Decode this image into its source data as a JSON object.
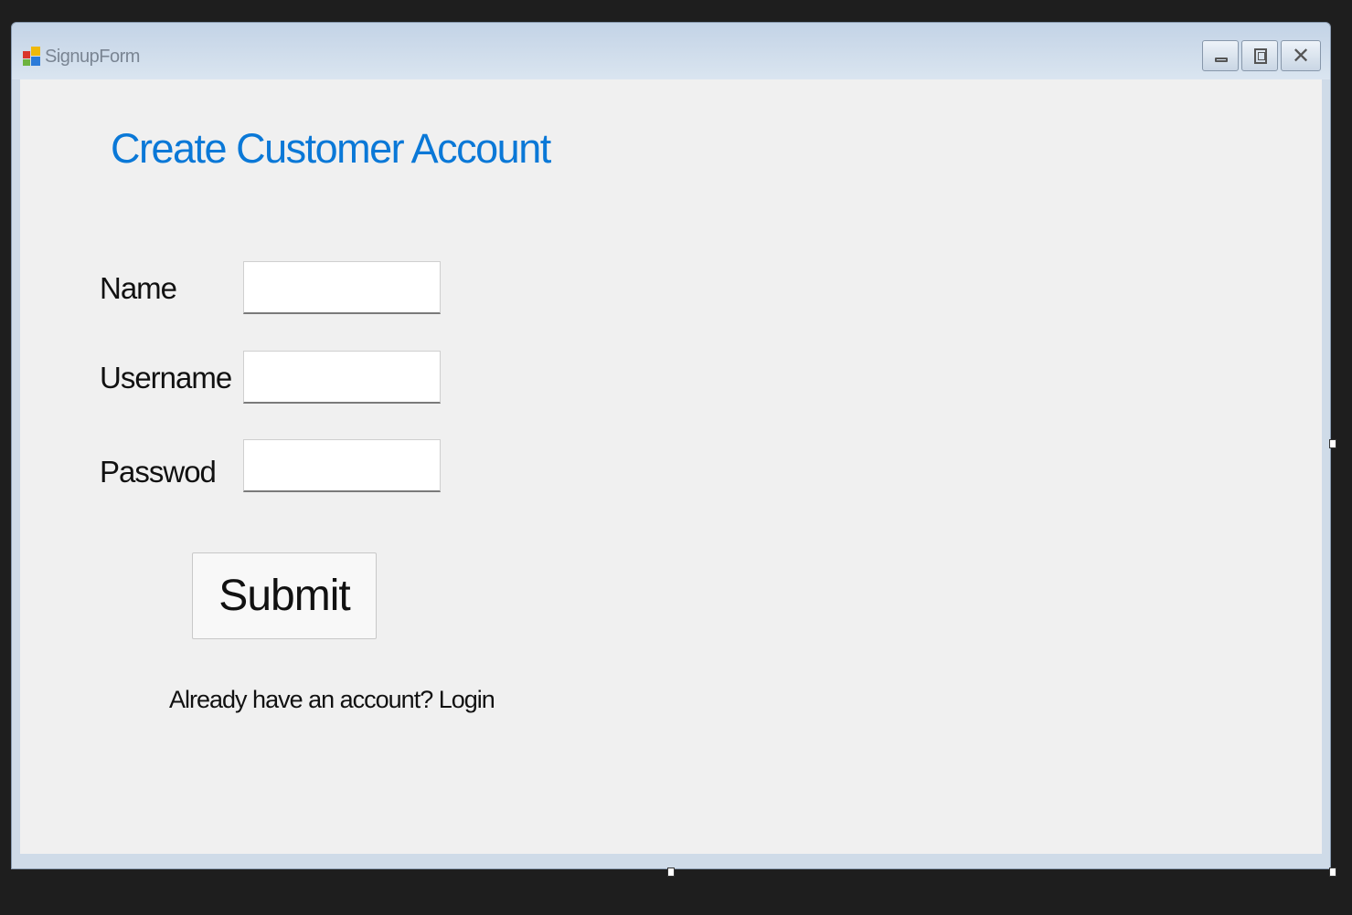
{
  "window": {
    "title": "SignupForm",
    "controls": {
      "minimize": "minimize-icon",
      "maximize": "maximize-icon",
      "close": "close-icon"
    }
  },
  "form": {
    "heading": "Create Customer Account",
    "fields": [
      {
        "label": "Name",
        "value": ""
      },
      {
        "label": "Username",
        "value": ""
      },
      {
        "label": "Passwod",
        "value": ""
      }
    ],
    "submit_label": "Submit",
    "login_link": "Already have an account? Login"
  },
  "colors": {
    "heading": "#0a78d7",
    "client_background": "#f0f0f0",
    "designer_background": "#1e1e1e"
  }
}
